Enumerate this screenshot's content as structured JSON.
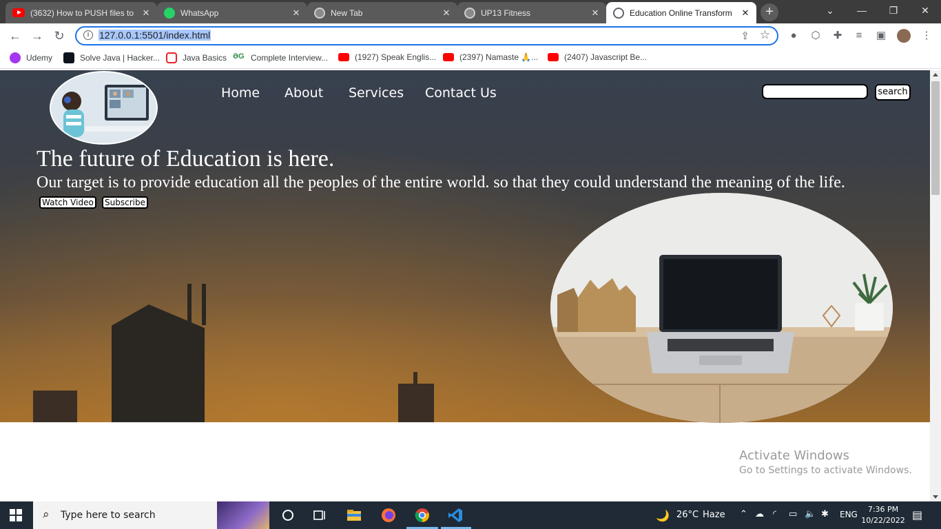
{
  "browser": {
    "tabs": [
      {
        "title": "(3632) How to PUSH files to",
        "icon": "youtube-icon",
        "active": false
      },
      {
        "title": "WhatsApp",
        "icon": "whatsapp-icon",
        "active": false
      },
      {
        "title": "New Tab",
        "icon": "chrome-icon",
        "active": false
      },
      {
        "title": "UP13 Fitness",
        "icon": "globe-icon",
        "active": false
      },
      {
        "title": "Education Online Transform",
        "icon": "globe-icon",
        "active": true
      }
    ],
    "new_tab_symbol": "+",
    "window_controls": {
      "list": "⌄",
      "minimize": "—",
      "maximize": "❐",
      "close": "✕"
    },
    "url": "127.0.0.1:5501/index.html",
    "bookmarks": [
      {
        "label": "Udemy",
        "icon": "udemy-icon"
      },
      {
        "label": "Solve Java | Hacker...",
        "icon": "hackerrank-icon"
      },
      {
        "label": "Java Basics",
        "icon": "java-icon"
      },
      {
        "label": "Complete Interview...",
        "icon": "geeksforgeeks-icon"
      },
      {
        "label": "(1927) Speak Englis...",
        "icon": "youtube-icon"
      },
      {
        "label": "(2397) Namaste 🙏...",
        "icon": "youtube-icon"
      },
      {
        "label": "(2407) Javascript Be...",
        "icon": "youtube-icon"
      }
    ]
  },
  "page": {
    "nav": [
      "Home",
      "About",
      "Services",
      "Contact Us"
    ],
    "search": {
      "value": "",
      "button_label": "search"
    },
    "hero_title": "The future of Education is here.",
    "hero_subtitle": "Our target is to provide education all the peoples of the entire world. so that they could understand the meaning of the life.",
    "buttons": {
      "watch": "Watch Video",
      "subscribe": "Subscribe"
    }
  },
  "watermark": {
    "line1": "Activate Windows",
    "line2": "Go to Settings to activate Windows."
  },
  "taskbar": {
    "search_placeholder": "Type here to search",
    "weather": {
      "temp": "26°C",
      "condition": "Haze"
    },
    "language": "ENG",
    "time": "7:36 PM",
    "date": "10/22/2022"
  },
  "colors": {
    "accent": "#1a73e8",
    "hero_top": "#37414f",
    "hero_bottom": "#9b6a2c",
    "taskbar": "#1f2a36"
  }
}
